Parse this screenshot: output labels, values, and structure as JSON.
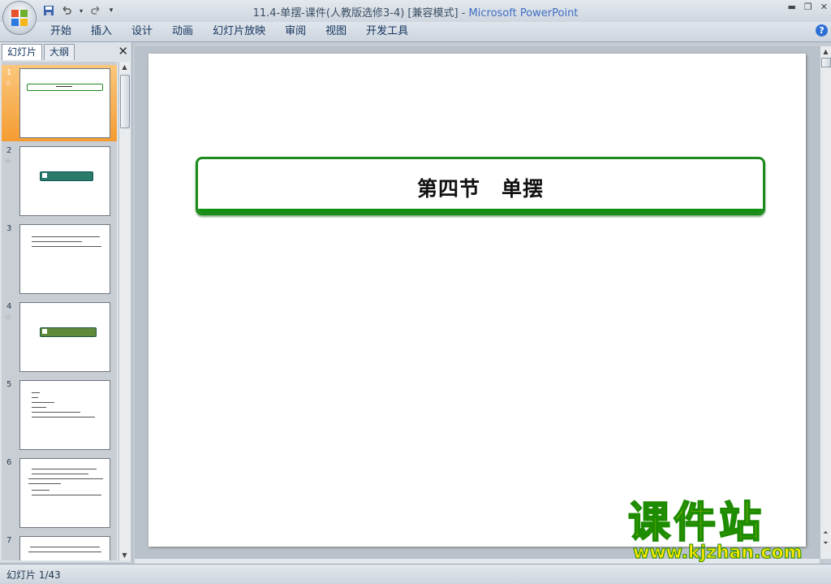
{
  "window": {
    "title": "11.4-单摆-课件(人教版选修3-4) [兼容模式]",
    "app_name": "Microsoft PowerPoint"
  },
  "ribbon": {
    "tabs": [
      "开始",
      "插入",
      "设计",
      "动画",
      "幻灯片放映",
      "审阅",
      "视图",
      "开发工具"
    ]
  },
  "pane": {
    "tab_slides": "幻灯片",
    "tab_outline": "大纲",
    "slides": [
      {
        "num": "1",
        "selected": true,
        "animated": true
      },
      {
        "num": "2",
        "selected": false,
        "animated": true
      },
      {
        "num": "3",
        "selected": false,
        "animated": false
      },
      {
        "num": "4",
        "selected": false,
        "animated": true
      },
      {
        "num": "5",
        "selected": false,
        "animated": false
      },
      {
        "num": "6",
        "selected": false,
        "animated": false
      },
      {
        "num": "7",
        "selected": false,
        "animated": false
      }
    ]
  },
  "slide": {
    "title": "第四节　单摆"
  },
  "status": {
    "slide_indicator": "幻灯片 1/43"
  },
  "watermark": {
    "text": "课件站",
    "url": "www.kjzhan.com"
  },
  "colors": {
    "accent_green": "#1d8a1d",
    "selected_thumb": "#f59c32"
  }
}
